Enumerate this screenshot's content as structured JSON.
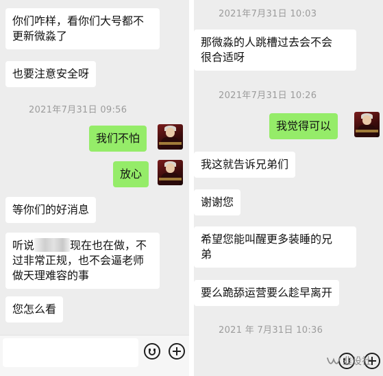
{
  "left": {
    "messages": [
      {
        "line1": "你们咋样，看你们大号都不",
        "line2": "更新微淼了"
      },
      {
        "text": "也要注意安全呀"
      },
      {
        "timestamp": "2021年7月31日 09:56"
      },
      {
        "text": "我们不怕"
      },
      {
        "text": "放心"
      },
      {
        "text": "等你们的好消息"
      },
      {
        "line1_pre": "听说",
        "line1_post": "现在也在做，不",
        "line2": "过非常正规，也不会逼老师",
        "line3": "做天理难容的事"
      },
      {
        "text": "您怎么看"
      }
    ]
  },
  "right": {
    "messages": [
      {
        "timestamp": "2021年7月31日 10:03"
      },
      {
        "line1": "那微淼的人跳槽过去会不会",
        "line2": "很合适呀"
      },
      {
        "timestamp": "2021年7月31日 10:26"
      },
      {
        "text": "我觉得可以"
      },
      {
        "text": "我这就告诉兄弟们"
      },
      {
        "text": "谢谢您"
      },
      {
        "line1": "希望您能叫醒更多装睡的兄",
        "line2": "弟"
      },
      {
        "text": "要么跪舔运营要么趁早离开"
      },
      {
        "timestamp": "2021 年 7月31日 10:36"
      }
    ]
  },
  "input_bar": {
    "emoji_icon": "smiley-face-icon",
    "plus_icon": "plus-circle-icon"
  },
  "watermark": {
    "text": "韭设社",
    "icon": "wechat-channel-icon"
  },
  "colors": {
    "background": "#ededed",
    "incoming_bubble": "#ffffff",
    "outgoing_bubble": "#95ec69",
    "timestamp": "#9b9b9b"
  }
}
